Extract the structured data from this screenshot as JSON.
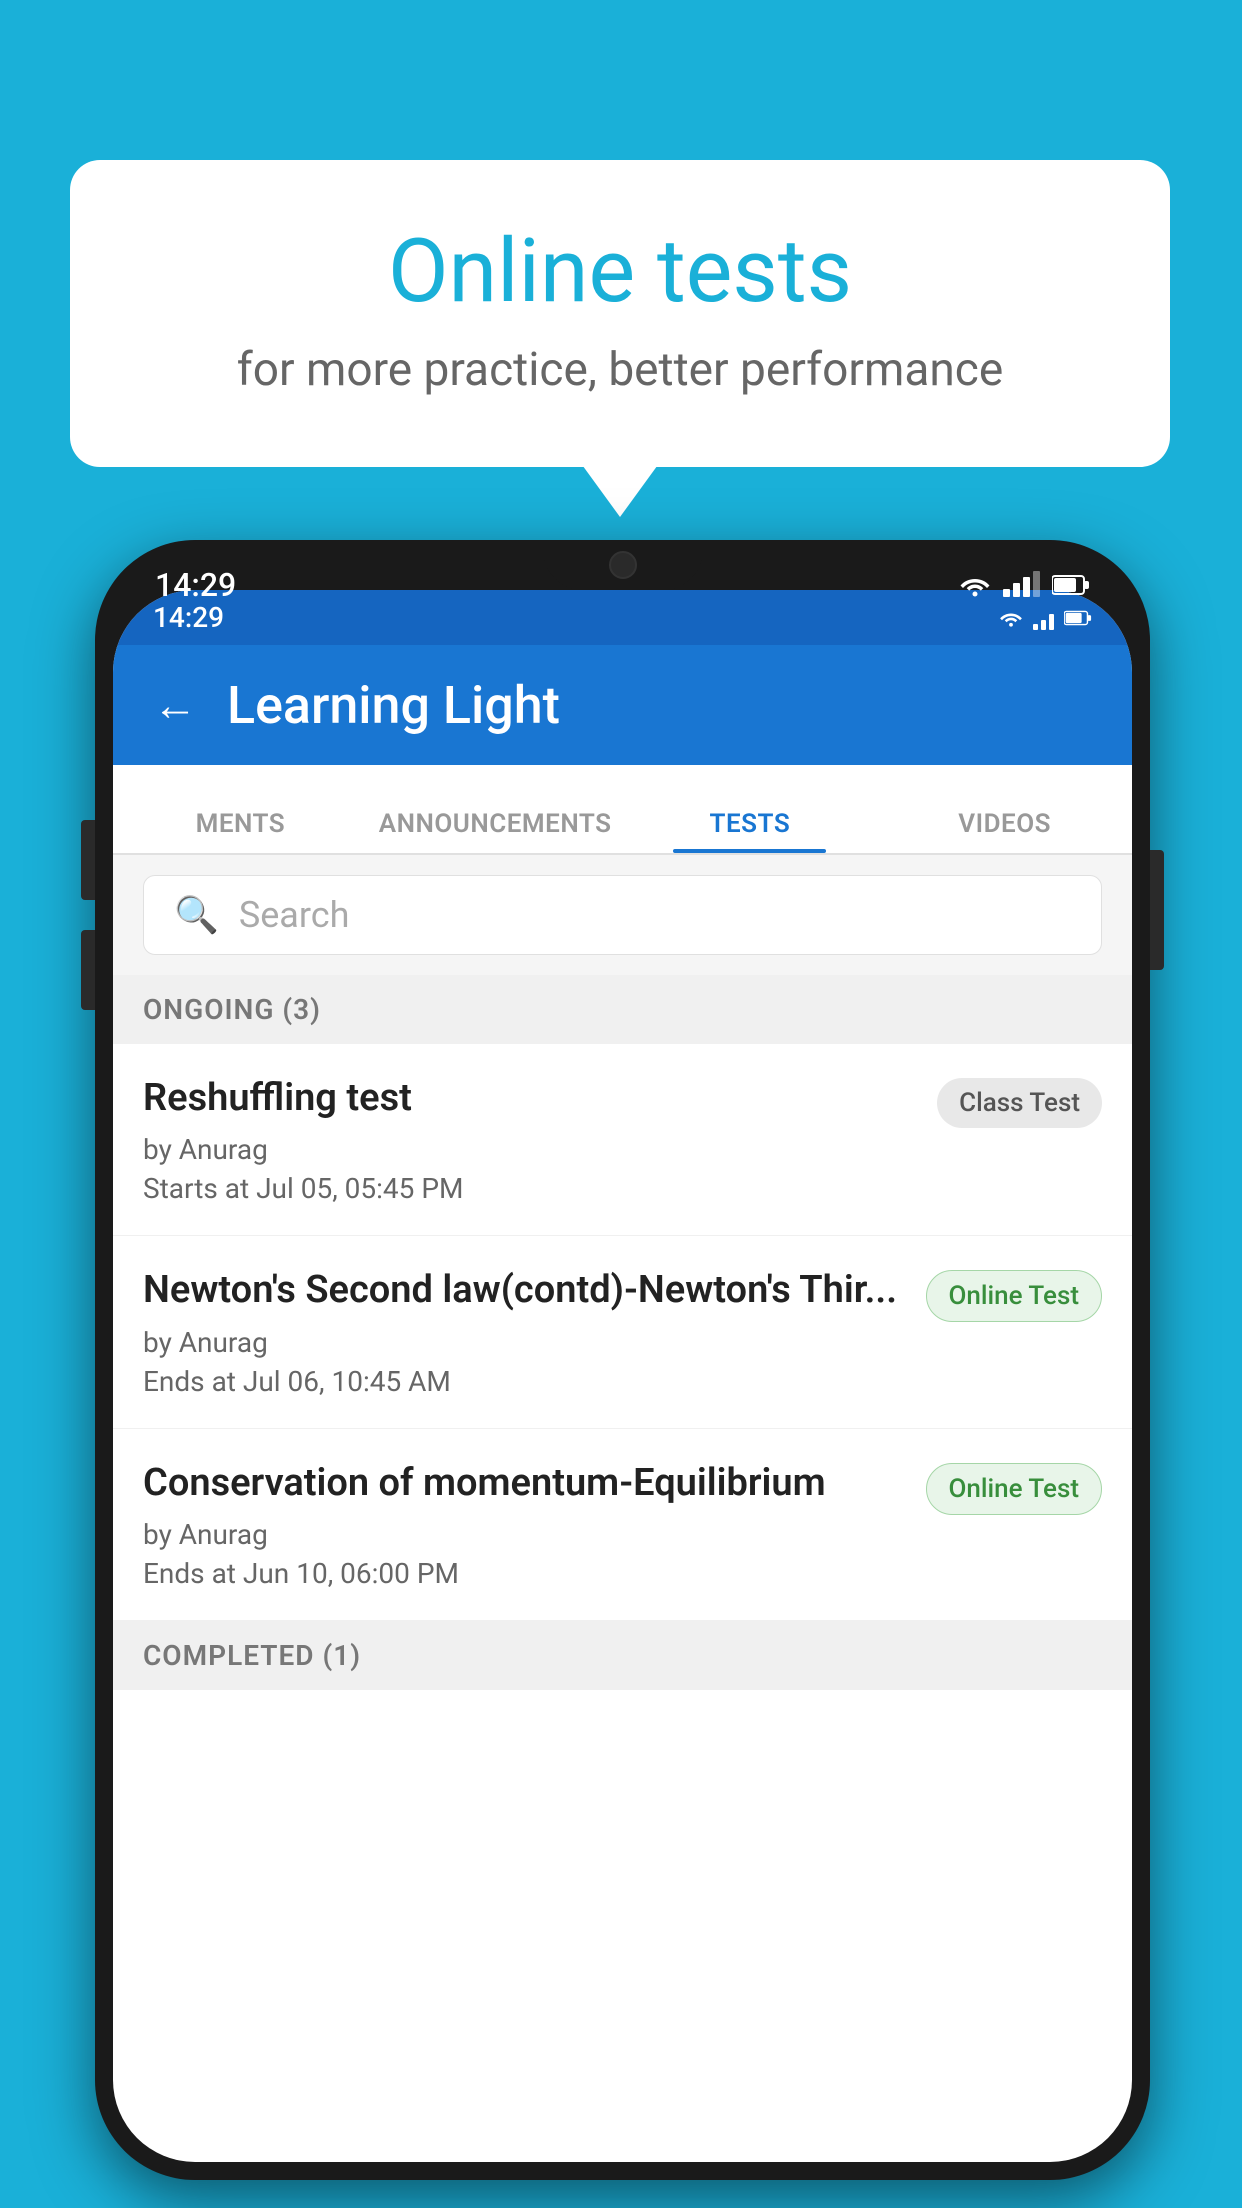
{
  "background_color": "#1ab0d8",
  "speech_bubble": {
    "title": "Online tests",
    "subtitle": "for more practice, better performance"
  },
  "phone": {
    "status_bar": {
      "time": "14:29",
      "icons": [
        "wifi",
        "signal",
        "battery"
      ]
    },
    "app_header": {
      "back_label": "←",
      "title": "Learning Light"
    },
    "tabs": [
      {
        "label": "MENTS",
        "active": false
      },
      {
        "label": "ANNOUNCEMENTS",
        "active": false
      },
      {
        "label": "TESTS",
        "active": true
      },
      {
        "label": "VIDEOS",
        "active": false
      }
    ],
    "search": {
      "placeholder": "Search"
    },
    "section_ongoing": {
      "label": "ONGOING (3)"
    },
    "tests_ongoing": [
      {
        "name": "Reshuffling test",
        "author": "by Anurag",
        "time_label": "Starts at",
        "time": "Jul 05, 05:45 PM",
        "badge": "Class Test",
        "badge_type": "class"
      },
      {
        "name": "Newton's Second law(contd)-Newton's Thir...",
        "author": "by Anurag",
        "time_label": "Ends at",
        "time": "Jul 06, 10:45 AM",
        "badge": "Online Test",
        "badge_type": "online"
      },
      {
        "name": "Conservation of momentum-Equilibrium",
        "author": "by Anurag",
        "time_label": "Ends at",
        "time": "Jun 10, 06:00 PM",
        "badge": "Online Test",
        "badge_type": "online"
      }
    ],
    "section_completed": {
      "label": "COMPLETED (1)"
    }
  }
}
